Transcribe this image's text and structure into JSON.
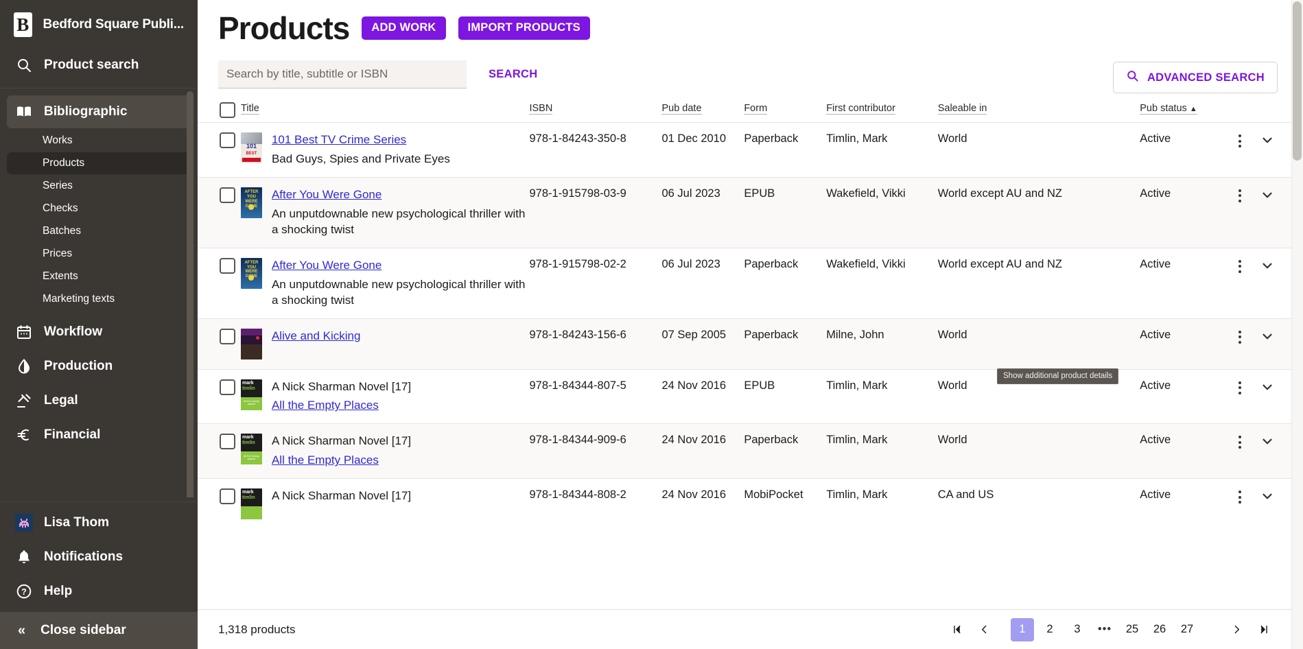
{
  "sidebar": {
    "brand": {
      "logo_letter": "B",
      "name": "Bedford Square Publi..."
    },
    "product_search": {
      "label": "Product search",
      "icon": "search-icon"
    },
    "nav": [
      {
        "label": "Bibliographic",
        "icon": "book-icon",
        "active": true,
        "children": [
          {
            "label": "Works",
            "active": false
          },
          {
            "label": "Products",
            "active": true
          },
          {
            "label": "Series",
            "active": false
          },
          {
            "label": "Checks",
            "active": false
          },
          {
            "label": "Batches",
            "active": false
          },
          {
            "label": "Prices",
            "active": false
          },
          {
            "label": "Extents",
            "active": false
          },
          {
            "label": "Marketing texts",
            "active": false
          }
        ]
      },
      {
        "label": "Workflow",
        "icon": "calendar-icon",
        "active": false,
        "children": []
      },
      {
        "label": "Production",
        "icon": "droplet-icon",
        "active": false,
        "children": []
      },
      {
        "label": "Legal",
        "icon": "gavel-icon",
        "active": false,
        "children": []
      },
      {
        "label": "Financial",
        "icon": "euro-icon",
        "active": false,
        "children": []
      }
    ],
    "account": [
      {
        "label": "Lisa Thom",
        "icon": "avatar"
      },
      {
        "label": "Notifications",
        "icon": "bell-icon"
      },
      {
        "label": "Help",
        "icon": "help-circle-icon"
      }
    ],
    "close": {
      "label": "Close sidebar",
      "icon": "chevron-double-left-icon"
    }
  },
  "header": {
    "title": "Products",
    "add_work_label": "ADD WORK",
    "import_products_label": "IMPORT PRODUCTS"
  },
  "search": {
    "placeholder": "Search by title, subtitle or ISBN",
    "value": "",
    "search_label": "SEARCH",
    "advanced_label": "ADVANCED SEARCH",
    "advanced_icon": "search-icon"
  },
  "table": {
    "columns": [
      {
        "key": "select",
        "label": ""
      },
      {
        "key": "title",
        "label": "Title"
      },
      {
        "key": "isbn",
        "label": "ISBN"
      },
      {
        "key": "pub_date",
        "label": "Pub date"
      },
      {
        "key": "form",
        "label": "Form"
      },
      {
        "key": "first_contributor",
        "label": "First contributor"
      },
      {
        "key": "saleable_in",
        "label": "Saleable in"
      },
      {
        "key": "pub_status",
        "label": "Pub status",
        "sort": "asc",
        "sort_glyph": "▲"
      }
    ],
    "rows": [
      {
        "series": "",
        "title": "101 Best TV Crime Series",
        "subtitle": "Bad Guys, Spies and Private Eyes",
        "isbn": "978-1-84243-350-8",
        "pub_date": "01 Dec 2010",
        "form": "Paperback",
        "first_contributor": "Timlin, Mark",
        "saleable_in": "World",
        "pub_status": "Active",
        "cover": {
          "bg": "#e8e2dc",
          "band": "#cf1020",
          "text": "101 BEST"
        }
      },
      {
        "series": "",
        "title": "After You Were Gone",
        "subtitle": "An unputdownable new psychological thriller with a shocking twist",
        "isbn": "978-1-915798-03-9",
        "pub_date": "06 Jul 2023",
        "form": "EPUB",
        "first_contributor": "Wakefield, Vikki",
        "saleable_in": "World except AU and NZ",
        "pub_status": "Active",
        "cover": {
          "bg": "#13386b",
          "band": "#e8c41a",
          "text": "AFTER YOU WERE GONE"
        }
      },
      {
        "series": "",
        "title": "After You Were Gone",
        "subtitle": "An unputdownable new psychological thriller with a shocking twist",
        "isbn": "978-1-915798-02-2",
        "pub_date": "06 Jul 2023",
        "form": "Paperback",
        "first_contributor": "Wakefield, Vikki",
        "saleable_in": "World except AU and NZ",
        "pub_status": "Active",
        "cover": {
          "bg": "#13386b",
          "band": "#e8c41a",
          "text": "AFTER YOU WERE GONE"
        }
      },
      {
        "series": "",
        "title": "Alive and Kicking",
        "subtitle": "",
        "isbn": "978-1-84243-156-6",
        "pub_date": "07 Sep 2005",
        "form": "Paperback",
        "first_contributor": "Milne, John",
        "saleable_in": "World",
        "pub_status": "Active",
        "cover": {
          "bg": "#2a1333",
          "band": "#7a2a8a",
          "text": "ALIVE AND KICKING"
        }
      },
      {
        "series": "A Nick Sharman Novel [17]",
        "title": "All the Empty Places",
        "subtitle": "",
        "isbn": "978-1-84344-807-5",
        "pub_date": "24 Nov 2016",
        "form": "EPUB",
        "first_contributor": "Timlin, Mark",
        "saleable_in": "World",
        "pub_status": "Active",
        "cover": {
          "bg": "#1c1c1c",
          "band": "#8dc63f",
          "text": "mark timlin"
        }
      },
      {
        "series": "A Nick Sharman Novel [17]",
        "title": "All the Empty Places",
        "subtitle": "",
        "isbn": "978-1-84344-909-6",
        "pub_date": "24 Nov 2016",
        "form": "Paperback",
        "first_contributor": "Timlin, Mark",
        "saleable_in": "World",
        "pub_status": "Active",
        "cover": {
          "bg": "#1c1c1c",
          "band": "#8dc63f",
          "text": "mark timlin"
        }
      },
      {
        "series": "A Nick Sharman Novel [17]",
        "title": "",
        "subtitle": "",
        "isbn": "978-1-84344-808-2",
        "pub_date": "24 Nov 2016",
        "form": "MobiPocket",
        "first_contributor": "Timlin, Mark",
        "saleable_in": "CA and US",
        "pub_status": "Active",
        "cover": {
          "bg": "#1c1c1c",
          "band": "#8dc63f",
          "text": "mark timlin"
        }
      }
    ],
    "row_actions": {
      "kebab": "more-options-icon",
      "expand": "chevron-down-icon"
    }
  },
  "tooltip": {
    "text": "Show additional product details"
  },
  "footer": {
    "count": "1,318 products",
    "pagination": {
      "first": "⧏|",
      "prev": "‹",
      "next": "›",
      "last": "|⧐",
      "ellipsis": "•••",
      "pages": [
        "1",
        "2",
        "3"
      ],
      "tail_pages": [
        "25",
        "26",
        "27"
      ],
      "current": "1"
    }
  },
  "colors": {
    "accent": "#7c16e0",
    "sidebar_bg": "#3b3733",
    "link": "#2f2ad0",
    "current_page": "#a29df0"
  }
}
